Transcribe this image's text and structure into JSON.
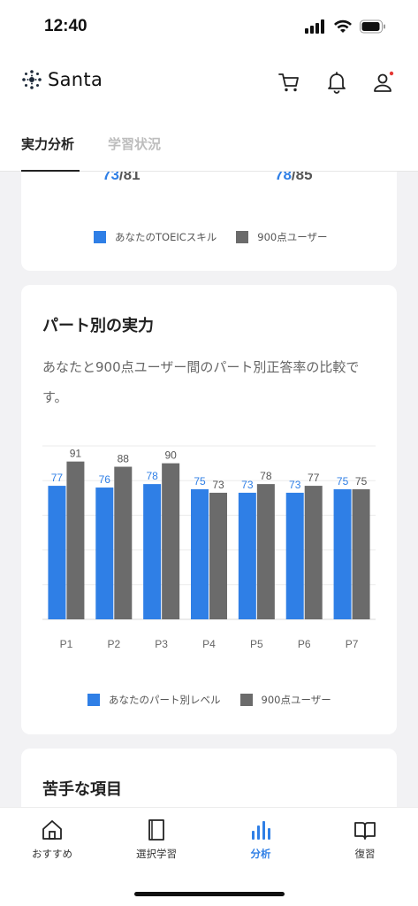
{
  "status": {
    "time": "12:40"
  },
  "app": {
    "logo_text": "Santa"
  },
  "tabs": [
    {
      "label": "実力分析",
      "active": true
    },
    {
      "label": "学習状況",
      "active": false
    }
  ],
  "skill_card": {
    "scores": [
      {
        "mine": "73",
        "total": "81"
      },
      {
        "mine": "78",
        "total": "85"
      }
    ],
    "legend": [
      {
        "label": "あなたのTOEICスキル",
        "color": "#2f7fe6"
      },
      {
        "label": "900点ユーザー",
        "color": "#6b6b6b"
      }
    ]
  },
  "part_card": {
    "title": "パート別の実力",
    "description": "あなたと900点ユーザー間のパート別正答率の比較です。",
    "legend": [
      {
        "label": "あなたのパート別レベル",
        "color": "#2f7fe6"
      },
      {
        "label": "900点ユーザー",
        "color": "#6b6b6b"
      }
    ]
  },
  "chart_data": {
    "type": "bar",
    "categories": [
      "P1",
      "P2",
      "P3",
      "P4",
      "P5",
      "P6",
      "P7"
    ],
    "series": [
      {
        "name": "あなたのパート別レベル",
        "color": "#2f7fe6",
        "values": [
          77,
          76,
          78,
          75,
          73,
          73,
          75
        ]
      },
      {
        "name": "900点ユーザー",
        "color": "#6b6b6b",
        "values": [
          91,
          88,
          90,
          73,
          78,
          77,
          75
        ]
      }
    ],
    "ylim": [
      0,
      100
    ],
    "grid": true
  },
  "weak_card": {
    "title": "苦手な項目"
  },
  "nav": [
    {
      "label": "おすすめ",
      "icon": "home-icon",
      "active": false
    },
    {
      "label": "選択学習",
      "icon": "book-icon",
      "active": false
    },
    {
      "label": "分析",
      "icon": "analysis-icon",
      "active": true
    },
    {
      "label": "復習",
      "icon": "review-book-icon",
      "active": false
    }
  ]
}
